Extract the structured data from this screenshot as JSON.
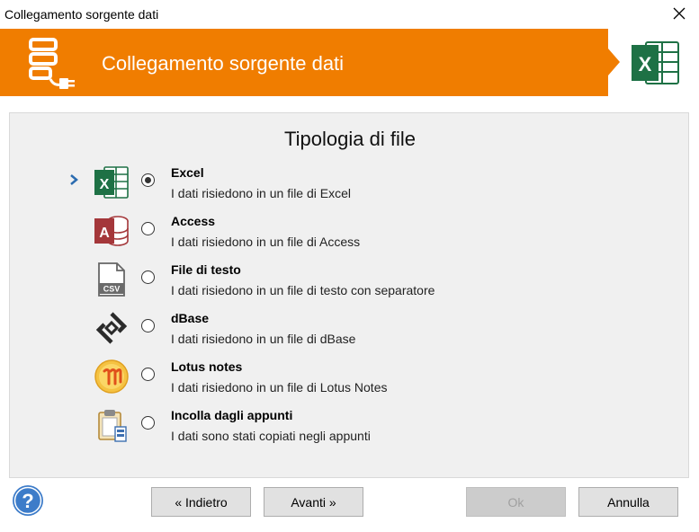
{
  "window": {
    "title": "Collegamento sorgente dati"
  },
  "banner": {
    "heading": "Collegamento sorgente dati"
  },
  "section": {
    "title": "Tipologia di file"
  },
  "options": [
    {
      "name": "Excel",
      "description": "I dati risiedono in un file di Excel",
      "icon": "excel-icon",
      "selected": true
    },
    {
      "name": "Access",
      "description": "I dati risiedono in un file di Access",
      "icon": "access-icon",
      "selected": false
    },
    {
      "name": "File di testo",
      "description": "I dati risiedono in un file di testo con separatore",
      "icon": "csv-file-icon",
      "selected": false
    },
    {
      "name": "dBase",
      "description": "I dati risiedono in un file di dBase",
      "icon": "dbase-icon",
      "selected": false
    },
    {
      "name": "Lotus notes",
      "description": "I dati risiedono in un file di Lotus Notes",
      "icon": "lotus-notes-icon",
      "selected": false
    },
    {
      "name": "Incolla dagli appunti",
      "description": "I dati sono stati copiati negli appunti",
      "icon": "clipboard-icon",
      "selected": false
    }
  ],
  "buttons": {
    "back": "« Indietro",
    "next": "Avanti »",
    "ok": "Ok",
    "cancel": "Annulla"
  },
  "colors": {
    "accent": "#f07d00",
    "excel_green": "#1e7145",
    "access_red": "#a4373a",
    "help_blue": "#3d7cc9"
  }
}
